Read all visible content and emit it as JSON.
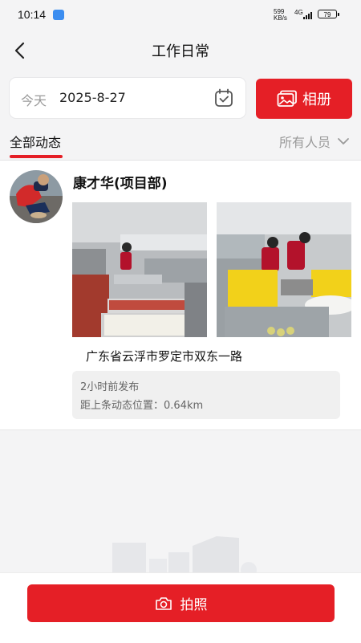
{
  "status_bar": {
    "time": "10:14",
    "net_speed_value": "599",
    "net_speed_unit": "KB/s",
    "network": "4G",
    "battery": "79"
  },
  "header": {
    "title": "工作日常",
    "back_icon": "chevron-left-icon"
  },
  "date_filter": {
    "label": "今天",
    "value": "2025-8-27",
    "calendar_icon": "calendar-check-icon"
  },
  "album_button": {
    "label": "相册",
    "icon": "album-icon"
  },
  "tabs": {
    "active": "全部动态",
    "people_filter": "所有人员",
    "dropdown_icon": "chevron-down-icon"
  },
  "feed": {
    "items": [
      {
        "author": "康才华(项目部)",
        "location": "广东省云浮市罗定市双东一路",
        "posted": "2小时前发布",
        "distance": "距上条动态位置：0.64km"
      }
    ]
  },
  "bottom_bar": {
    "photo_button_label": "拍照",
    "camera_icon": "camera-icon"
  },
  "colors": {
    "accent": "#e51f26",
    "background": "#f4f4f5"
  }
}
